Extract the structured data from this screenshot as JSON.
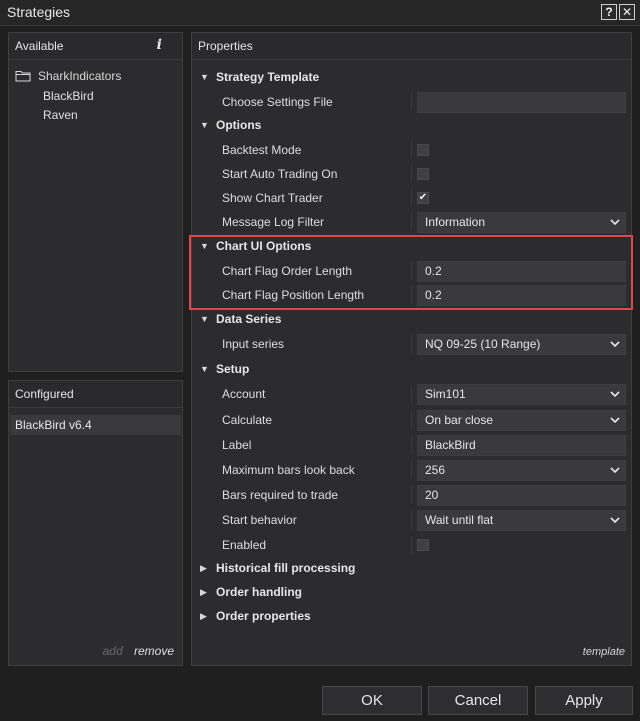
{
  "window": {
    "title": "Strategies",
    "help_label": "?",
    "close_label": "✕"
  },
  "available": {
    "header": "Available",
    "info_label": "i",
    "folder": "SharkIndicators",
    "items": [
      "BlackBird",
      "Raven"
    ]
  },
  "configured": {
    "header": "Configured",
    "items": [
      "BlackBird v6.4"
    ],
    "add_label": "add",
    "remove_label": "remove"
  },
  "properties": {
    "header": "Properties",
    "template_label": "template",
    "categories": {
      "strategy_template": "Strategy Template",
      "options": "Options",
      "chart_ui_options": "Chart UI Options",
      "data_series": "Data Series",
      "setup": "Setup",
      "historical_fill": "Historical fill processing",
      "order_handling": "Order handling",
      "order_properties": "Order properties"
    },
    "rows": {
      "choose_settings_file": {
        "label": "Choose Settings File",
        "value": ""
      },
      "backtest_mode": {
        "label": "Backtest Mode",
        "checked": false
      },
      "start_auto_trading": {
        "label": "Start Auto Trading On",
        "checked": false
      },
      "show_chart_trader": {
        "label": "Show Chart Trader",
        "checked": true,
        "mark": "✔"
      },
      "message_log_filter": {
        "label": "Message Log Filter",
        "value": "Information"
      },
      "chart_flag_order_length": {
        "label": "Chart Flag Order Length",
        "value": "0.2"
      },
      "chart_flag_position_length": {
        "label": "Chart Flag Position Length",
        "value": "0.2"
      },
      "input_series": {
        "label": "Input series",
        "value": "NQ 09-25 (10 Range)"
      },
      "account": {
        "label": "Account",
        "value": "Sim101"
      },
      "calculate": {
        "label": "Calculate",
        "value": "On bar close"
      },
      "label": {
        "label": "Label",
        "value": "BlackBird"
      },
      "max_bars_look_back": {
        "label": "Maximum bars look back",
        "value": "256"
      },
      "bars_required": {
        "label": "Bars required to trade",
        "value": "20"
      },
      "start_behavior": {
        "label": "Start behavior",
        "value": "Wait until flat"
      },
      "enabled": {
        "label": "Enabled",
        "checked": false
      }
    }
  },
  "buttons": {
    "ok": "OK",
    "cancel": "Cancel",
    "apply": "Apply"
  },
  "colors": {
    "highlight": "#e0474c",
    "background": "#1f1f1f",
    "panel": "#2c2c2e"
  },
  "icons": {
    "expanded": "triangle-down-icon",
    "collapsed": "triangle-right-icon",
    "folder": "folder-icon",
    "dropdown": "chevron-down-icon"
  }
}
